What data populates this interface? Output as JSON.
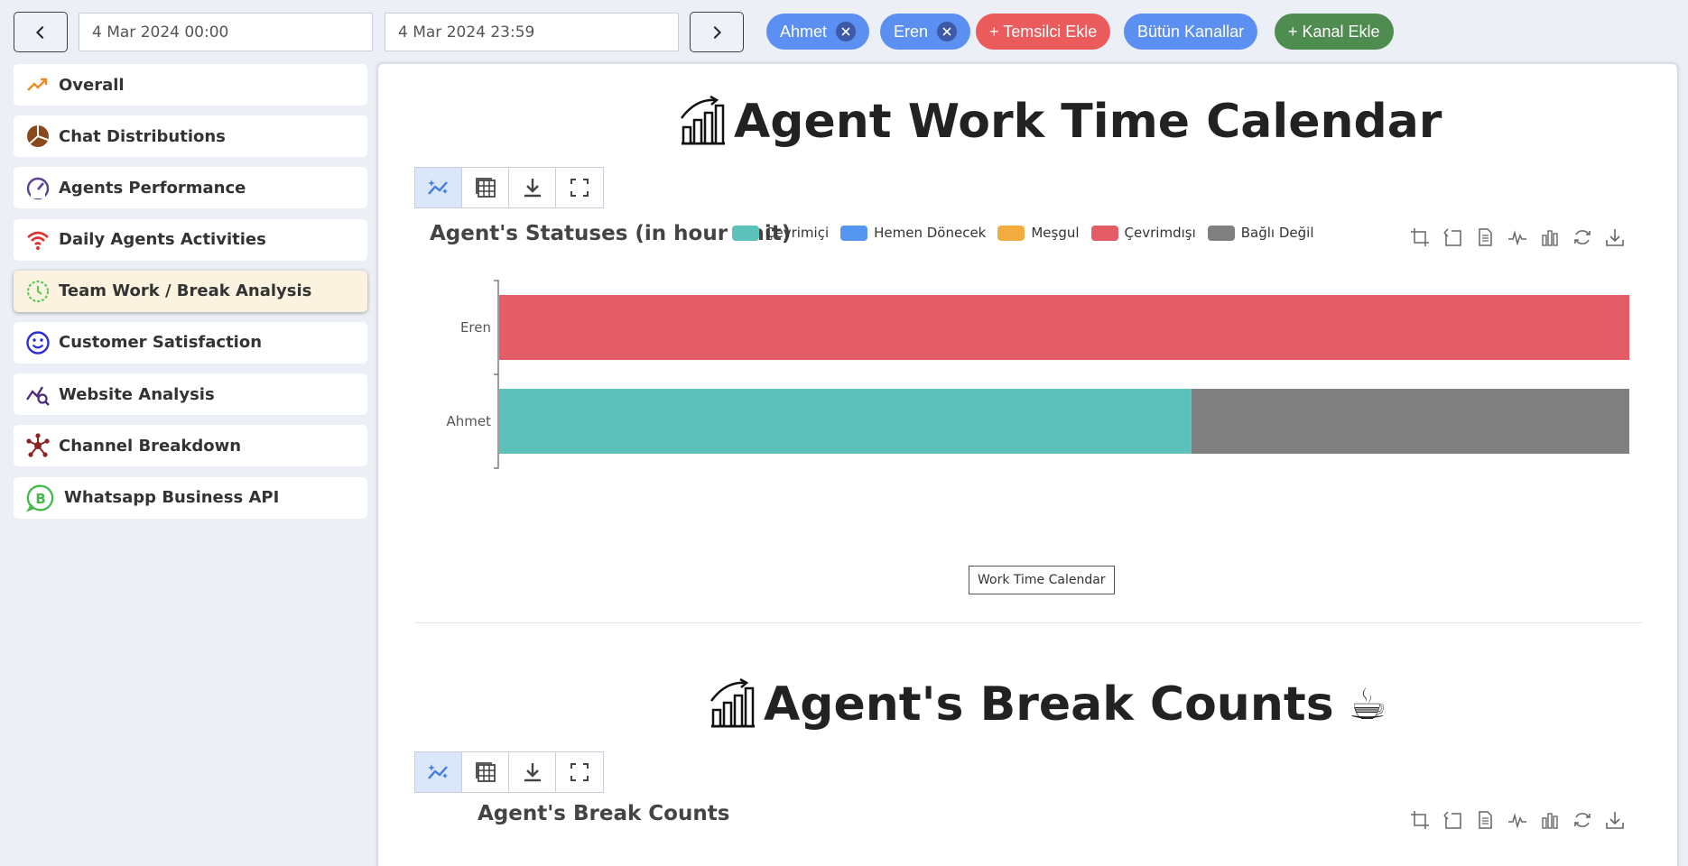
{
  "filters": {
    "start_date": "4 Mar 2024 00:00",
    "end_date": "4 Mar 2024 23:59",
    "agents": [
      "Ahmet",
      "Eren"
    ],
    "add_agent_label": "+ Temsilci Ekle",
    "all_channels_label": "Bütün Kanallar",
    "add_channel_label": "+ Kanal Ekle",
    "colors": {
      "agent_chip": "#5b8ff2",
      "add_agent": "#ec5b5b",
      "all_channels": "#5b8ff2",
      "add_channel": "#4f8c4f"
    }
  },
  "sidebar": {
    "items": [
      {
        "label": "Overall",
        "icon": "trending-up-icon",
        "active": false
      },
      {
        "label": "Chat Distributions",
        "icon": "pie-chart-icon",
        "active": false
      },
      {
        "label": "Agents Performance",
        "icon": "speedometer-icon",
        "active": false
      },
      {
        "label": "Daily Agents Activities",
        "icon": "wifi-icon",
        "active": false
      },
      {
        "label": "Team Work / Break Analysis",
        "icon": "clock-icon",
        "active": true
      },
      {
        "label": "Customer Satisfaction",
        "icon": "smiley-icon",
        "active": false
      },
      {
        "label": "Website Analysis",
        "icon": "chart-search-icon",
        "active": false
      },
      {
        "label": "Channel Breakdown",
        "icon": "network-icon",
        "active": false
      },
      {
        "label": "Whatsapp Business API",
        "icon": "whatsapp-business-icon",
        "active": false
      }
    ]
  },
  "main": {
    "section1": {
      "title": "Agent Work Time Calendar",
      "chart_title": "Agent's Statuses (in hour unit)",
      "calendar_label": "Work Time Calendar"
    },
    "section2": {
      "title": "Agent's Break Counts",
      "chart_title": "Agent's Break Counts"
    }
  },
  "chart_data": {
    "type": "bar",
    "orientation": "horizontal",
    "stacked": true,
    "title": "Agent's Statuses (in hour unit)",
    "categories": [
      "Eren",
      "Ahmet"
    ],
    "series": [
      {
        "name": "Çevrimiçi",
        "color": "#5cc0bb",
        "values": [
          0,
          14.7
        ]
      },
      {
        "name": "Hemen Dönecek",
        "color": "#5596f0",
        "values": [
          0,
          0
        ]
      },
      {
        "name": "Meşgul",
        "color": "#f2ac3e",
        "values": [
          0,
          0
        ]
      },
      {
        "name": "Çevrimdışı",
        "color": "#e35c66",
        "values": [
          24,
          0
        ]
      },
      {
        "name": "Bağlı Değil",
        "color": "#808080",
        "values": [
          0,
          9.3
        ]
      }
    ],
    "xlim": [
      0,
      24
    ],
    "legend_position": "top",
    "grid": false
  }
}
